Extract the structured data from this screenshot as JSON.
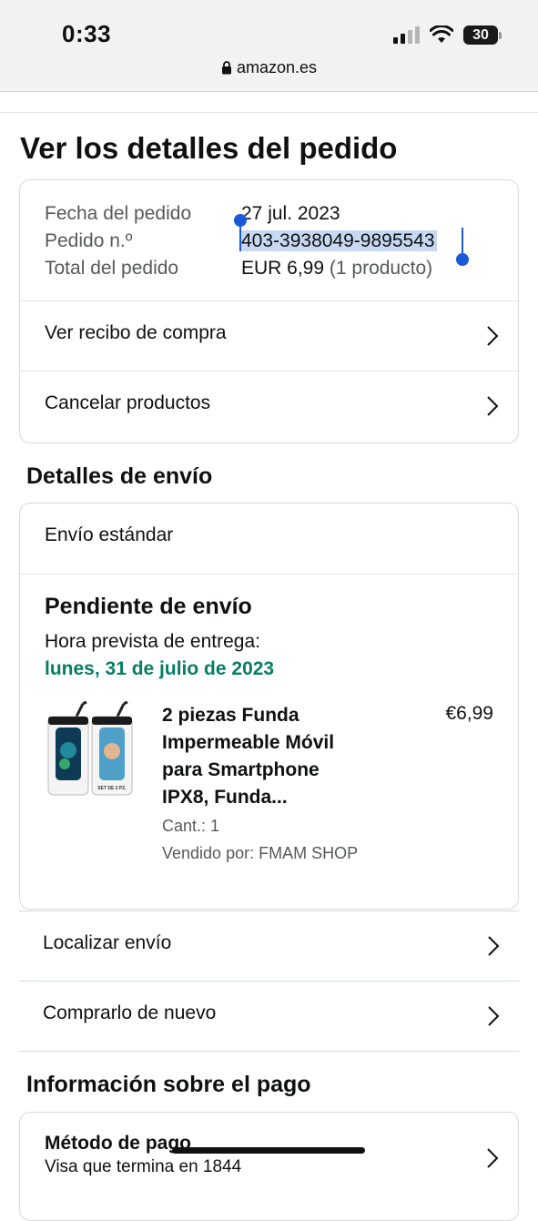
{
  "status_bar": {
    "time": "0:33",
    "battery": "30",
    "url": "amazon.es"
  },
  "page": {
    "title": "Ver los detalles del pedido"
  },
  "summary": {
    "date_label": "Fecha del pedido",
    "date_value": "27 jul. 2023",
    "order_label": "Pedido n.º",
    "order_value": "403-3938049-9895543",
    "total_label": "Total del pedido",
    "total_value": "EUR 6,99",
    "total_count": "(1 producto)"
  },
  "actions": {
    "receipt": "Ver recibo de compra",
    "cancel": "Cancelar productos"
  },
  "shipping": {
    "section_title": "Detalles de envío",
    "type": "Envío estándar",
    "status": "Pendiente de envío",
    "eta_label": "Hora prevista de entrega:",
    "eta_date": "lunes, 31 de julio de 2023",
    "product": {
      "title_line1": "2 piezas Funda",
      "title_line2": "Impermeable Móvil",
      "title_line3": "para Smartphone",
      "title_line4": "IPX8, Funda...",
      "price": "€6,99",
      "qty": "Cant.: 1",
      "seller": "Vendido por: FMAM SHOP",
      "image_label": "SET DE 2 PZ."
    },
    "track": "Localizar envío",
    "buy_again": "Comprarlo de nuevo"
  },
  "payment": {
    "section_title": "Información sobre el pago",
    "method_label": "Método de pago",
    "method_value": "Visa que termina en 1844"
  },
  "colors": {
    "accent_green": "#067d62",
    "selection": "#c7d8f2",
    "handle": "#1a5ad9"
  }
}
